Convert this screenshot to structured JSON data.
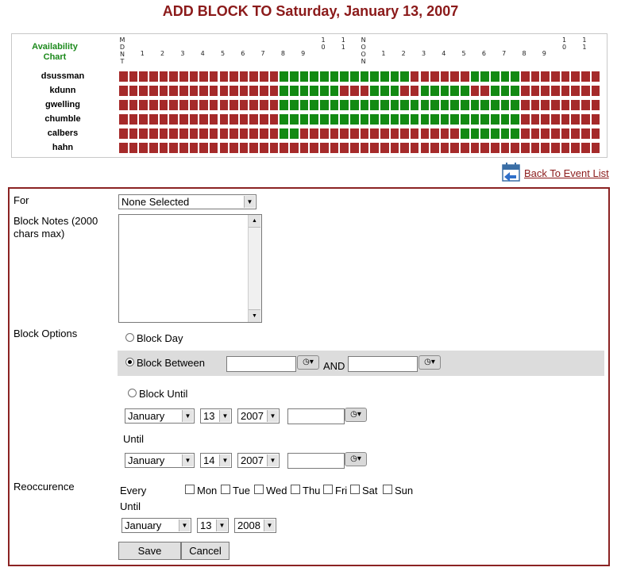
{
  "page": {
    "title": "ADD BLOCK TO Saturday, January 13, 2007"
  },
  "chart": {
    "label": "Availability Chart",
    "hour_labels": [
      "MDNT",
      "1",
      "2",
      "3",
      "4",
      "5",
      "6",
      "7",
      "8",
      "9",
      "10",
      "11",
      "NOON",
      "1",
      "2",
      "3",
      "4",
      "5",
      "6",
      "7",
      "8",
      "9",
      "10",
      "11"
    ],
    "users": [
      {
        "name": "dsussman",
        "free_slots": [
          [
            16,
            28
          ],
          [
            35,
            39
          ]
        ]
      },
      {
        "name": "kdunn",
        "free_slots": [
          [
            16,
            21
          ],
          [
            25,
            27
          ],
          [
            30,
            34
          ],
          [
            37,
            39
          ]
        ]
      },
      {
        "name": "gwelling",
        "free_slots": [
          [
            16,
            39
          ]
        ]
      },
      {
        "name": "chumble",
        "free_slots": [
          [
            16,
            39
          ]
        ]
      },
      {
        "name": "calbers",
        "free_slots": [
          [
            16,
            17
          ],
          [
            34,
            39
          ]
        ]
      },
      {
        "name": "hahn",
        "free_slots": []
      }
    ],
    "slots_per_user": 48,
    "colors": {
      "busy": "#a52a2a",
      "free": "#138a13"
    }
  },
  "nav": {
    "back_label": "Back To Event List",
    "back_icon": "calendar-back-icon"
  },
  "form": {
    "for_label": "For",
    "for_value": "None Selected",
    "notes_label": "Block Notes (2000 chars max)",
    "options_label": "Block Options",
    "block_day": "Block Day",
    "block_between": "Block Between",
    "and_label": "AND",
    "block_until": "Block Until",
    "start_month": "January",
    "start_day": "13",
    "start_year": "2007",
    "until_label": "Until",
    "end_month": "January",
    "end_day": "14",
    "end_year": "2007",
    "reoccurence_label": "Reoccurence",
    "every_label": "Every",
    "days": [
      "Mon",
      "Tue",
      "Wed",
      "Thu",
      "Fri",
      "Sat",
      "Sun"
    ],
    "rec_until_label": "Until",
    "rec_month": "January",
    "rec_day": "13",
    "rec_year": "2008",
    "save_label": "Save",
    "cancel_label": "Cancel"
  }
}
